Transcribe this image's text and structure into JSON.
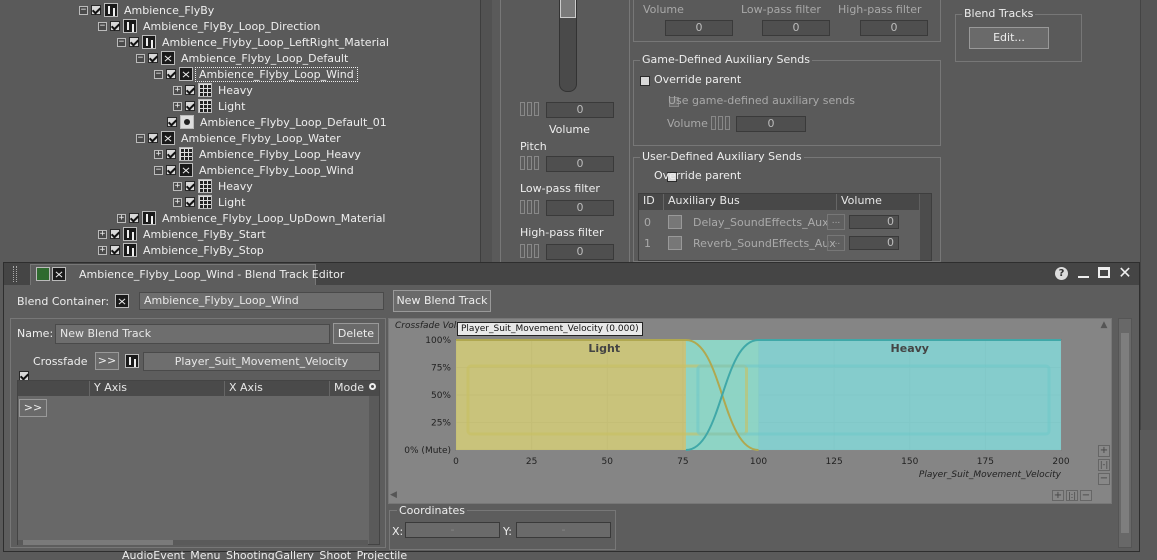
{
  "tree": [
    {
      "label": "Ambience_FlyBy",
      "icon": "seq"
    },
    {
      "label": "Ambience_FlyBy_Loop_Direction",
      "icon": "seq"
    },
    {
      "label": "Ambience_Flyby_Loop_LeftRight_Material",
      "icon": "seq"
    },
    {
      "label": "Ambience_Flyby_Loop_Default",
      "icon": "blend"
    },
    {
      "label": "Ambience_Flyby_Loop_Wind",
      "icon": "blend"
    },
    {
      "label": "Heavy",
      "icon": "grid"
    },
    {
      "label": "Light",
      "icon": "grid"
    },
    {
      "label": "Ambience_Flyby_Loop_Default_01",
      "icon": "snd"
    },
    {
      "label": "Ambience_Flyby_Loop_Water",
      "icon": "blend"
    },
    {
      "label": "Ambience_Flyby_Loop_Heavy",
      "icon": "grid"
    },
    {
      "label": "Ambience_Flyby_Loop_Wind",
      "icon": "blend"
    },
    {
      "label": "Heavy",
      "icon": "grid"
    },
    {
      "label": "Light",
      "icon": "grid"
    },
    {
      "label": "Ambience_Flyby_Loop_UpDown_Material",
      "icon": "seq"
    },
    {
      "label": "Ambience_FlyBy_Start",
      "icon": "seq"
    },
    {
      "label": "Ambience_FlyBy_Stop",
      "icon": "seq"
    }
  ],
  "mid": {
    "volume_label": "Volume",
    "volume_value": "0",
    "pitch_label": "Pitch",
    "pitch_value": "0",
    "lpf_label": "Low-pass filter",
    "lpf_value": "0",
    "hpf_label": "High-pass filter",
    "hpf_value": "0"
  },
  "right": {
    "top_cols": [
      "Volume",
      "Low-pass filter",
      "High-pass filter"
    ],
    "top_values": [
      "0",
      "0",
      "0"
    ],
    "game_sends_title": "Game-Defined Auxiliary Sends",
    "override_parent": "Override parent",
    "use_game_defined": "Use game-defined auxiliary sends",
    "volume_label": "Volume",
    "volume_value": "0",
    "user_sends_title": "User-Defined Auxiliary Sends",
    "user_override_parent": "Override parent",
    "cols": [
      "ID",
      "Auxiliary Bus",
      "Volume"
    ],
    "rows": [
      {
        "id": "0",
        "bus": "Delay_SoundEffects_Aux",
        "vol": "0"
      },
      {
        "id": "1",
        "bus": "Reverb_SoundEffects_Aux",
        "vol": "0"
      }
    ],
    "blend_tracks_title": "Blend Tracks",
    "edit_label": "Edit..."
  },
  "editor": {
    "title": "Ambience_Flyby_Loop_Wind - Blend Track Editor",
    "blend_container_label": "Blend Container:",
    "blend_container_value": "Ambience_Flyby_Loop_Wind",
    "new_track_label": "New Blend Track",
    "name_label": "Name:",
    "name_value": "New Blend Track",
    "delete_label": "Delete",
    "crossfade_label": "Crossfade",
    "arrow_label": ">>",
    "param_value": "Player_Suit_Movement_Velocity",
    "cols": [
      "Y Axis",
      "X Axis",
      "Mode"
    ],
    "expand_label": ">>",
    "coords_title": "Coordinates",
    "x_label": "X:",
    "y_label": "Y:",
    "x_value": "-",
    "y_value": "-",
    "help_icon": "?",
    "bottom_text": "AudioEvent_Menu_ShootingGallery_Shoot_Projectile"
  },
  "chart_data": {
    "type": "area",
    "title": "Crossfade Volume",
    "tooltip": "Player_Suit_Movement_Velocity (0.000)",
    "xlabel": "Player_Suit_Movement_Velocity",
    "xlim": [
      0,
      200
    ],
    "xticks": [
      "0",
      "25",
      "50",
      "75",
      "100",
      "125",
      "150",
      "175",
      "200"
    ],
    "ylim": [
      0,
      100
    ],
    "yticks": [
      "0% (Mute)",
      "25%",
      "50%",
      "75%",
      "100%"
    ],
    "regions": [
      {
        "name": "Light",
        "x_start": 0,
        "x_end": 100,
        "fade_out_start": 76,
        "color": "#d8d070"
      },
      {
        "name": "Heavy",
        "x_start": 76,
        "x_end": 200,
        "fade_in_end": 100,
        "color": "#7fd8d8"
      }
    ],
    "grid": true
  }
}
